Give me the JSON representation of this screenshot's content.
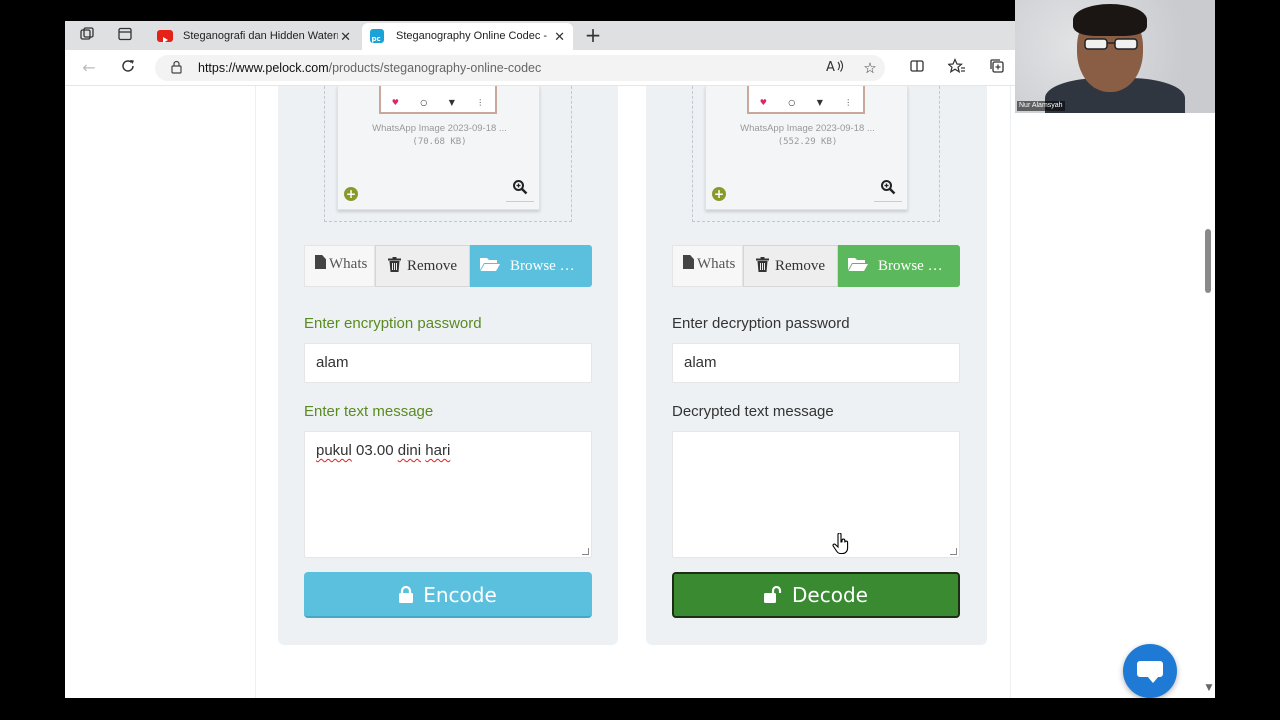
{
  "browser": {
    "tabs": [
      {
        "title": "Steganografi dan Hidden Waterm",
        "favicon": "youtube-icon",
        "active": false
      },
      {
        "title": "Steganography Online Codec - H",
        "favicon": "pelock-icon",
        "active": true
      }
    ],
    "url": {
      "host": "https://www.pelock.com",
      "path": "/products/steganography-online-codec"
    }
  },
  "encode_panel": {
    "image_name": "WhatsApp Image 2023-09-18 ...",
    "image_size": "(70.68 KB)",
    "file_name_short": "Whats",
    "remove_label": "Remove",
    "browse_label": "Browse …",
    "password_label": "Enter encryption password",
    "password_value": "alam",
    "message_label": "Enter text message",
    "message_words": [
      "pukul",
      "03.00",
      "dini",
      "hari"
    ],
    "button_label": "Encode"
  },
  "decode_panel": {
    "image_name": "WhatsApp Image 2023-09-18 ...",
    "image_size": "(552.29 KB)",
    "file_name_short": "Whats",
    "remove_label": "Remove",
    "browse_label": "Browse …",
    "password_label": "Enter decryption password",
    "password_value": "alam",
    "message_label": "Decrypted text message",
    "message_value": "",
    "button_label": "Decode"
  },
  "webcam": {
    "participant_name": "Nur Alamsyah"
  },
  "colors": {
    "success_label": "#5a8a22",
    "info_button": "#5bc0de",
    "success_button": "#5cb85c",
    "decode_button": "#3a8a32",
    "chat_button": "#1f7ad6"
  }
}
